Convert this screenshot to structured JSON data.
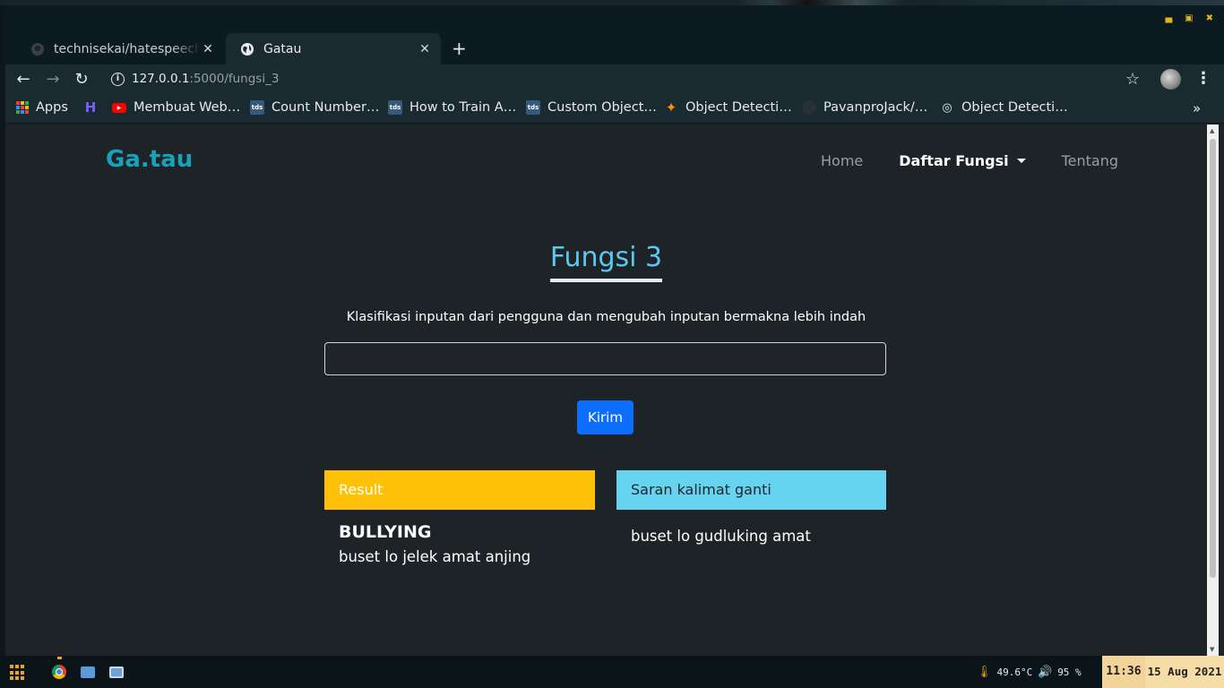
{
  "browser": {
    "tabs": [
      {
        "title": "technisekai/hatespeech-a",
        "icon": "github-icon",
        "active": false
      },
      {
        "title": "Gatau",
        "icon": "globe-icon",
        "active": true
      }
    ],
    "url_host": "127.0.0.1",
    "url_path": ":5000/fungsi_3",
    "bookmarks": [
      {
        "label": "Apps",
        "icon": "apps-grid-icon"
      },
      {
        "label": "",
        "icon": "h-logo-icon"
      },
      {
        "label": "Membuat Web…",
        "icon": "youtube-icon"
      },
      {
        "label": "Count Number…",
        "icon": "tds-icon"
      },
      {
        "label": "How to Train A…",
        "icon": "tds-icon"
      },
      {
        "label": "Custom Object…",
        "icon": "tds-icon"
      },
      {
        "label": "Object Detecti…",
        "icon": "tensorflow-icon"
      },
      {
        "label": "PavanproJack/…",
        "icon": "github-icon"
      },
      {
        "label": "Object Detecti…",
        "icon": "record-icon"
      }
    ],
    "tds_label": "tds",
    "more_label": "»"
  },
  "page": {
    "brand": "Ga.tau",
    "nav": {
      "home": "Home",
      "daftar_fungsi": "Daftar Fungsi",
      "tentang": "Tentang"
    },
    "title": "Fungsi 3",
    "description": "Klasifikasi inputan dari pengguna dan mengubah inputan bermakna lebih indah",
    "input_value": "",
    "submit_label": "Kirim",
    "result_card": {
      "header": "Result",
      "label": "BULLYING",
      "text": "buset lo jelek amat anjing",
      "color": "#ffc107"
    },
    "saran_card": {
      "header": "Saran kalimat ganti",
      "text": "buset lo gudluking amat",
      "color": "#66d4f0"
    }
  },
  "taskbar": {
    "temperature": "49.6°C",
    "volume": "95 %",
    "time": "11:36",
    "date": "15 Aug 2021",
    "accent": "#e8a320"
  }
}
